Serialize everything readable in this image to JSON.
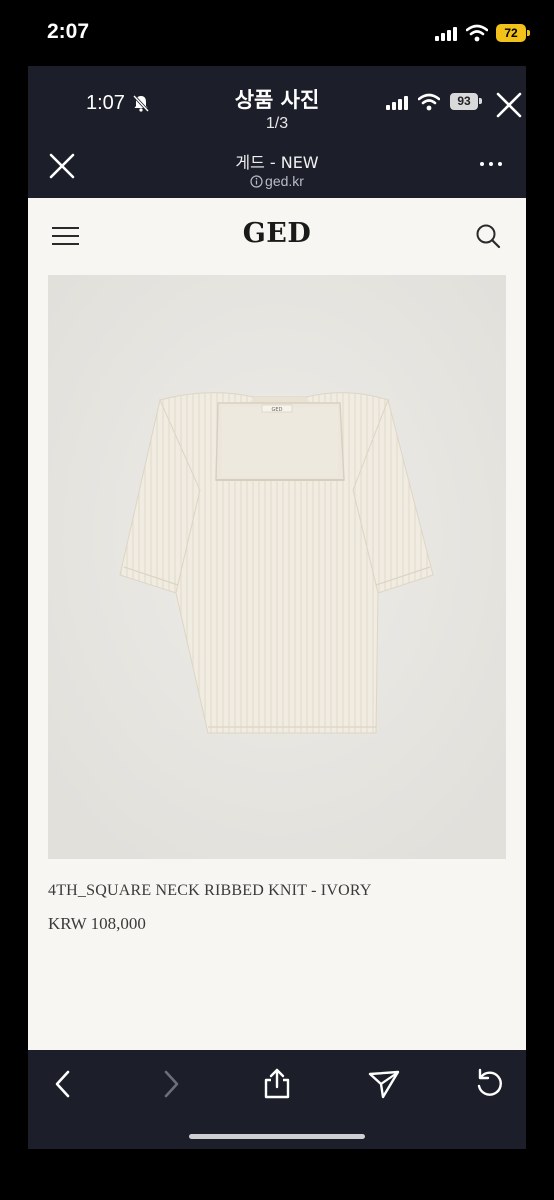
{
  "outer_status": {
    "time": "2:07",
    "battery": "72"
  },
  "viewer": {
    "time": "1:07",
    "title": "상품 사진",
    "counter": "1/3",
    "battery": "93"
  },
  "browser": {
    "site_name": "게드 - NEW",
    "site_url": "ged.kr"
  },
  "page": {
    "logo": "GED",
    "product_name": "4TH_SQUARE NECK RIBBED KNIT - IVORY",
    "product_price": "KRW 108,000",
    "garment_label": "GED"
  },
  "colors": {
    "frame_bg": "#1c1f2a",
    "page_bg": "#f7f6f2",
    "image_bg": "#e8e6e1",
    "garment": "#f1ece1",
    "battery_accent": "#f2c21b"
  }
}
